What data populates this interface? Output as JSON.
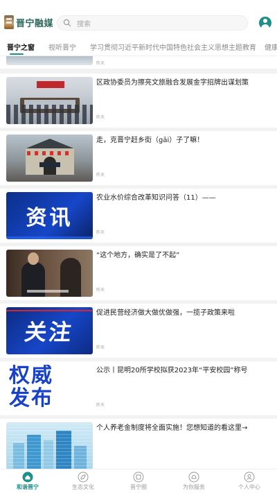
{
  "header": {
    "app_name": "晋宁融媒",
    "search_placeholder": "搜索"
  },
  "tabs": [
    {
      "label": "晋宁之窗",
      "active": true
    },
    {
      "label": "视听晋宁",
      "active": false
    },
    {
      "label": "学习贯彻习近平新时代中国特色社会主义思想主题教育",
      "active": false
    },
    {
      "label": "健康",
      "active": false
    }
  ],
  "feed": {
    "partial_time": "昨天",
    "items": [
      {
        "headline": "区政协委员为擦亮文旅融合发展金字招牌出谋划策",
        "time": "昨天",
        "thumb": "meeting-photo"
      },
      {
        "headline": "走，克晋宁赶乡街（gāi）子了嘛！",
        "time": "昨天",
        "thumb": "gate-photo"
      },
      {
        "headline": "农业水价综合改革知识问答（11）——",
        "time": "昨天",
        "thumb": "资讯"
      },
      {
        "headline": "“这个地方，确实是了不起”",
        "time": "昨天",
        "thumb": "interview-photo"
      },
      {
        "headline": "促进民营经济做大做优做强，一揽子政策来啦",
        "time": "昨天",
        "thumb": "关注"
      },
      {
        "headline": "公示丨昆明20所学校拟获2023年“平安校园”称号",
        "time": "昨天",
        "thumb": "权威发布"
      },
      {
        "headline": "个人养老金制度将全面实施！您想知道的看这里→",
        "time": "",
        "thumb": "city-illustration"
      }
    ],
    "thumb_text": {
      "zixun": "资讯",
      "guanzhu": "关注",
      "quanwei_1": "权威",
      "quanwei_2": "发布"
    }
  },
  "bottom_nav": [
    {
      "label": "和谐晋宁",
      "icon": "home-icon",
      "active": true
    },
    {
      "label": "生态文化",
      "icon": "leaf-icon",
      "active": false
    },
    {
      "label": "晋宁圈",
      "icon": "circle-icon",
      "active": false
    },
    {
      "label": "为你服务",
      "icon": "service-icon",
      "active": false
    },
    {
      "label": "个人中心",
      "icon": "user-icon",
      "active": false
    }
  ],
  "colors": {
    "accent": "#1f8f8b",
    "news_blue": "#1646c8"
  }
}
